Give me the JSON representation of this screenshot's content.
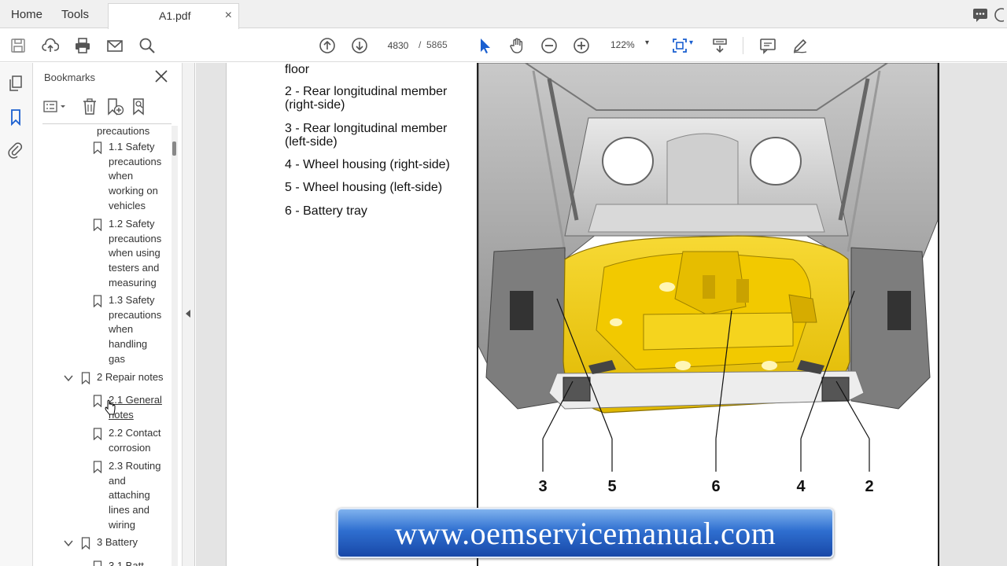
{
  "topbar": {
    "home_label": "Home",
    "tools_label": "Tools",
    "tab_title": "A1.pdf",
    "tab_close": "×"
  },
  "toolbar": {
    "current_page": "4830",
    "page_separator": "/",
    "total_pages": "5865",
    "zoom": "122%",
    "icons": [
      "save-icon",
      "upload-cloud-icon",
      "print-icon",
      "mail-icon",
      "search-icon",
      "page-up-icon",
      "page-down-icon",
      "select-cursor-icon",
      "hand-icon",
      "zoom-out-icon",
      "zoom-in-icon",
      "fit-page-icon",
      "scroll-mode-icon",
      "comment-icon",
      "pen-icon"
    ]
  },
  "bookmarks": {
    "title": "Bookmarks",
    "items": [
      {
        "lines": [
          "precautions"
        ]
      },
      {
        "lines": [
          "1.1 Safety",
          "precautions",
          "when",
          "working on",
          "vehicles"
        ]
      },
      {
        "lines": [
          "1.2 Safety",
          "precautions",
          "when using",
          "testers and",
          "measuring"
        ]
      },
      {
        "lines": [
          "1.3 Safety",
          "precautions",
          "when",
          "handling",
          "gas"
        ]
      },
      {
        "lines": [
          "2 Repair notes"
        ]
      },
      {
        "lines": [
          "2.1 General",
          "notes"
        ]
      },
      {
        "lines": [
          "2.2 Contact",
          "corrosion"
        ]
      },
      {
        "lines": [
          "2.3 Routing",
          "and",
          "attaching",
          "lines and",
          "wiring"
        ]
      },
      {
        "lines": [
          "3 Battery"
        ]
      },
      {
        "lines": [
          "3.1 Batt"
        ]
      }
    ]
  },
  "document": {
    "lines": [
      "floor",
      "2 - Rear longitudinal member",
      "(right-side)",
      "3 - Rear longitudinal member",
      "(left-side)",
      "4 - Wheel housing (right-side)",
      "5 - Wheel housing (left-side)",
      "6 - Battery tray"
    ],
    "figure_callouts": [
      "3",
      "5",
      "6",
      "4",
      "2"
    ]
  },
  "banner": {
    "text": "www.oemservicemanual.com"
  },
  "colors": {
    "battery_tray": "#f2cc00",
    "banner_blue": "#2f6fd0",
    "accent_blue": "#1a73e8"
  }
}
